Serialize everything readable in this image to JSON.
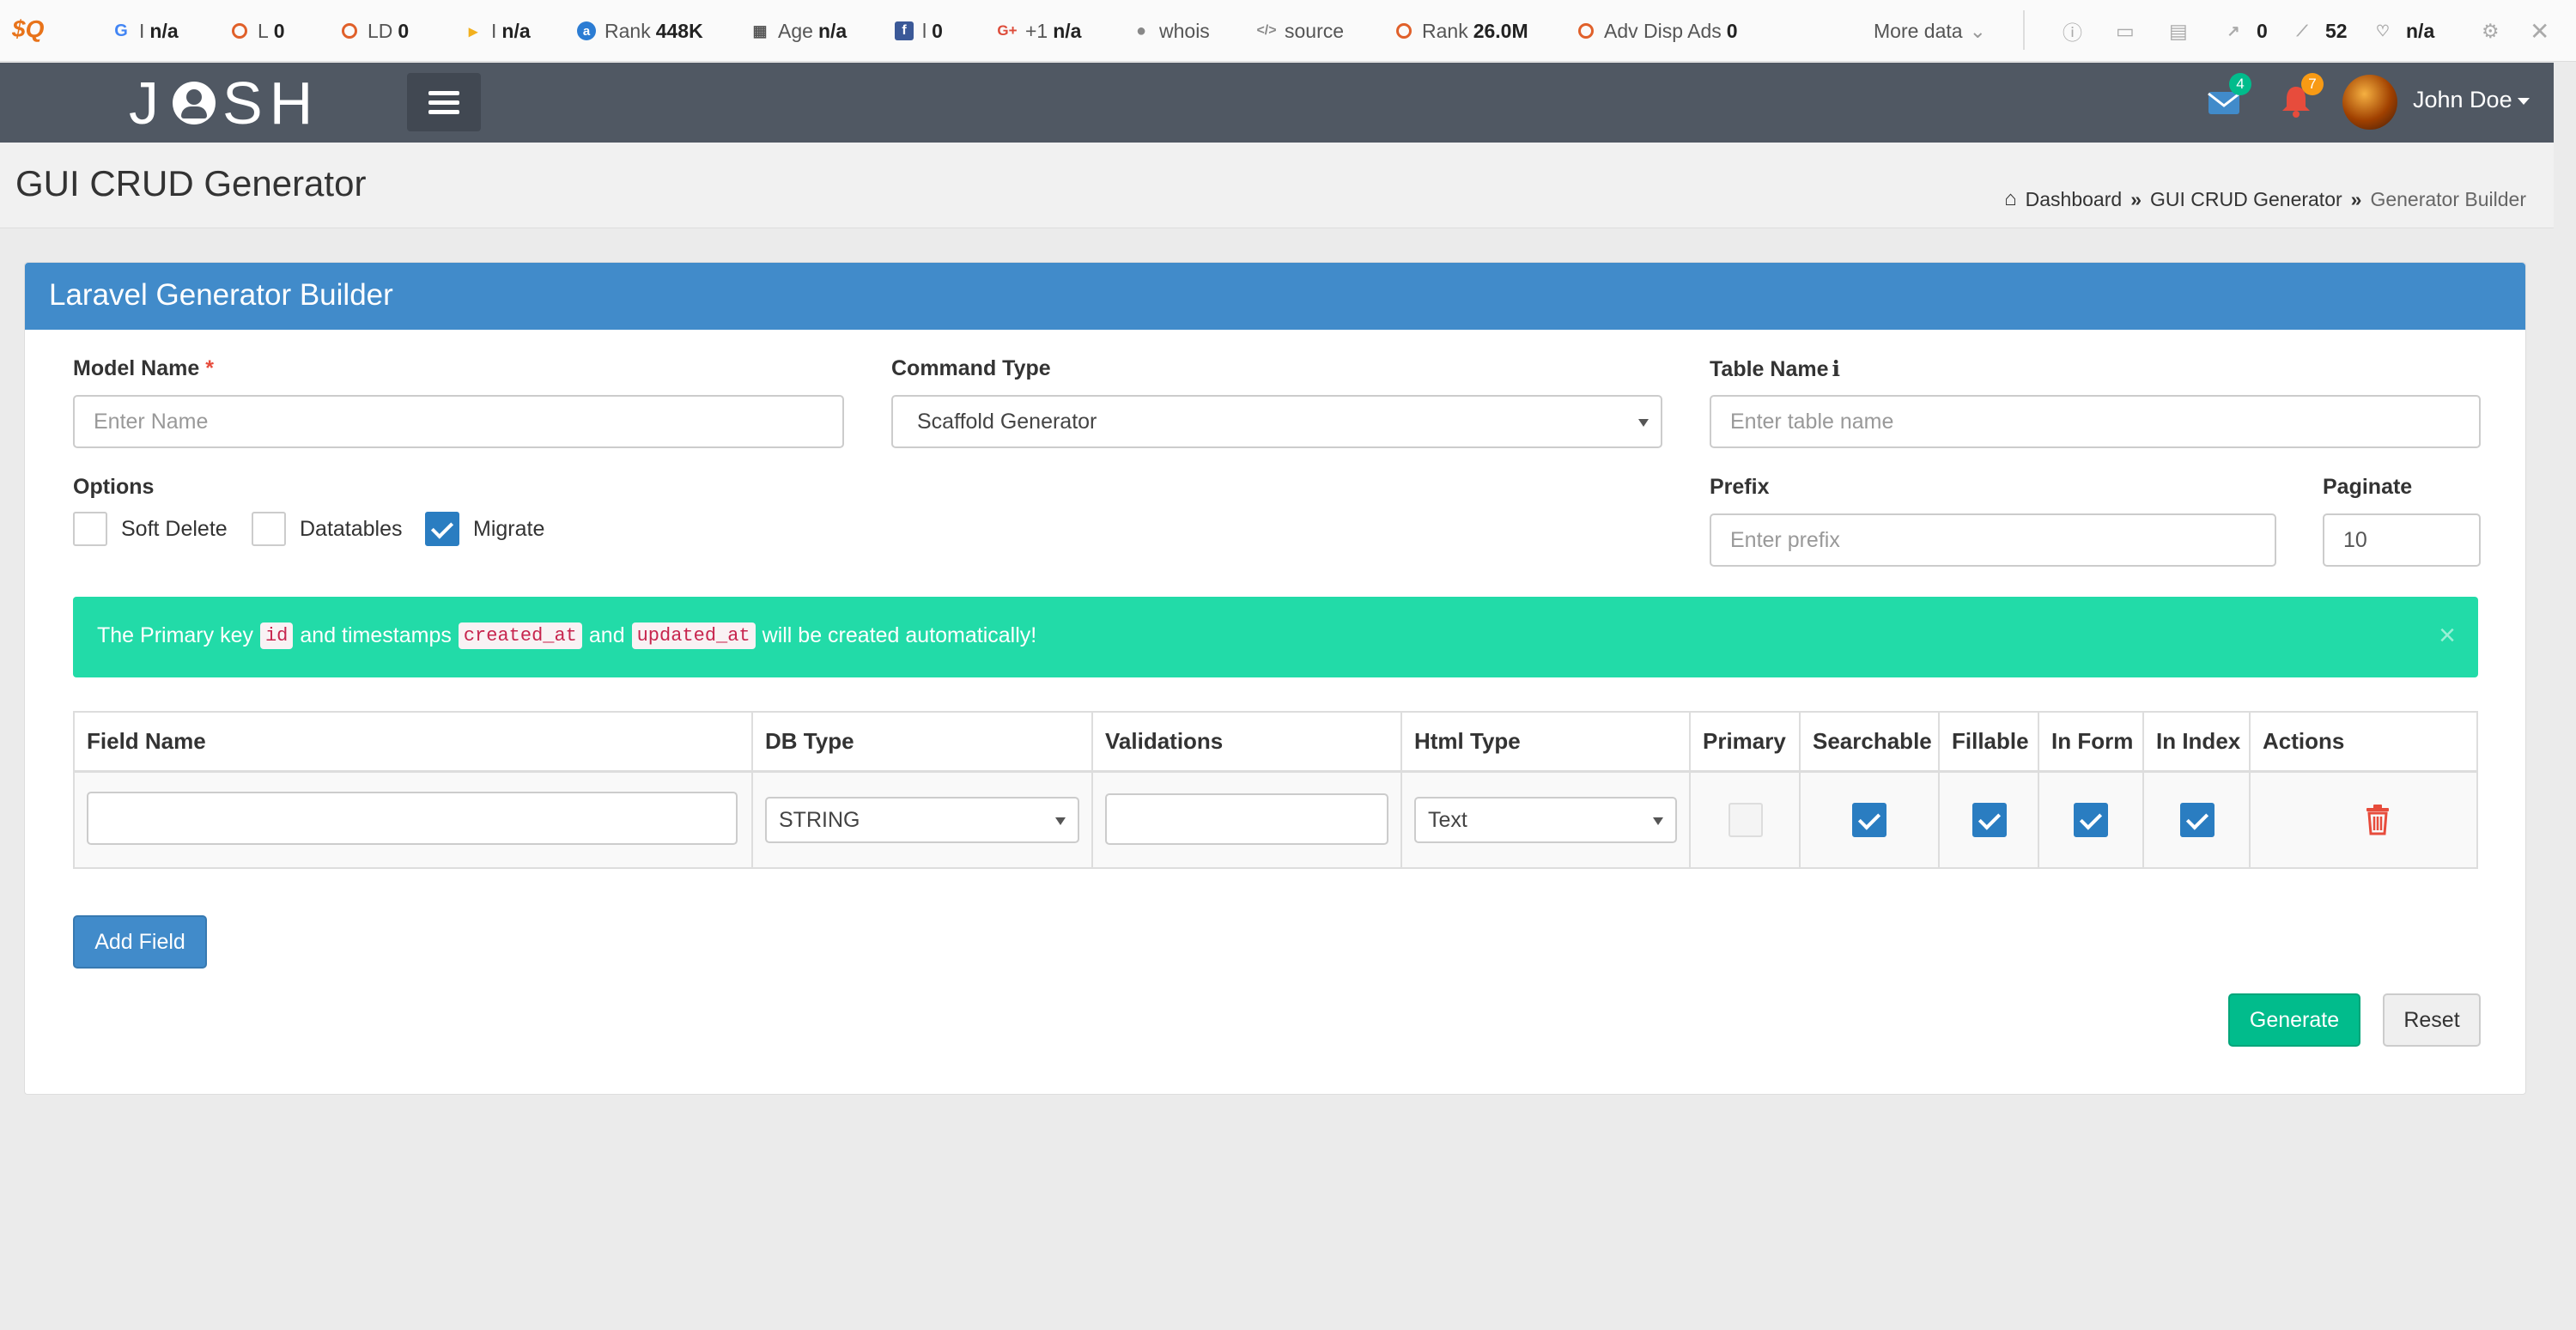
{
  "seobar": {
    "items": [
      {
        "icon": "google-icon",
        "label": "I",
        "value": "n/a",
        "color": "#4285f4"
      },
      {
        "icon": "circle-icon",
        "label": "L",
        "value": "0"
      },
      {
        "icon": "circle-icon",
        "label": "LD",
        "value": "0"
      },
      {
        "icon": "bing-icon",
        "label": "I",
        "value": "n/a"
      },
      {
        "icon": "alexa-icon",
        "label": "Rank",
        "value": "448K"
      },
      {
        "icon": "calendar-icon",
        "label": "Age",
        "value": "n/a"
      },
      {
        "icon": "facebook-icon",
        "label": "l",
        "value": "0"
      },
      {
        "icon": "google-plus-icon",
        "label": "+1",
        "value": "n/a"
      },
      {
        "icon": "person-icon",
        "label": "whois",
        "value": ""
      },
      {
        "icon": "code-icon",
        "label": "source",
        "value": ""
      },
      {
        "icon": "circle-icon",
        "label": "Rank",
        "value": "26.0M"
      },
      {
        "icon": "circle-icon",
        "label": "Adv Disp Ads",
        "value": "0"
      }
    ],
    "more_data": "More data",
    "right_values": {
      "links": "0",
      "pages": "52",
      "heart": "n/a"
    }
  },
  "navbar": {
    "logo_left": "J",
    "logo_right": "SH",
    "mail_count": "4",
    "notif_count": "7",
    "user_name": "John Doe",
    "colors": {
      "bar": "#505863",
      "mail_badge": "#01bc8c",
      "notif_badge": "#f89a14"
    }
  },
  "header": {
    "title": "GUI CRUD Generator",
    "breadcrumb": [
      "Dashboard",
      "GUI CRUD Generator",
      "Generator Builder"
    ]
  },
  "panel": {
    "title": "Laravel Generator Builder",
    "model_name": {
      "label": "Model Name",
      "required": "*",
      "placeholder": "Enter Name"
    },
    "command_type": {
      "label": "Command Type",
      "value": "Scaffold Generator"
    },
    "table_name": {
      "label": "Table Name",
      "info": "i",
      "placeholder": "Enter table name"
    },
    "options": {
      "label": "Options",
      "items": [
        {
          "label": "Soft Delete",
          "checked": false
        },
        {
          "label": "Datatables",
          "checked": false
        },
        {
          "label": "Migrate",
          "checked": true
        }
      ]
    },
    "prefix": {
      "label": "Prefix",
      "placeholder": "Enter prefix"
    },
    "paginate": {
      "label": "Paginate",
      "value": "10"
    },
    "alert": {
      "text1": "The Primary key",
      "code1": "id",
      "text2": "and timestamps",
      "code2": "created_at",
      "text3": "and",
      "code3": "updated_at",
      "text4": "will be created automatically!",
      "close": "×"
    },
    "table": {
      "headers": [
        "Field Name",
        "DB Type",
        "Validations",
        "Html Type",
        "Primary",
        "Searchable",
        "Fillable",
        "In Form",
        "In Index",
        "Actions"
      ],
      "row": {
        "field_name": "",
        "db_type": "STRING",
        "validations": "",
        "html_type": "Text",
        "primary": false,
        "searchable": true,
        "fillable": true,
        "in_form": true,
        "in_index": true
      }
    },
    "buttons": {
      "add_field": "Add Field",
      "generate": "Generate",
      "reset": "Reset"
    },
    "colors": {
      "heading": "#418bca",
      "alert": "#22dba8",
      "generate": "#01bc8c",
      "checkbox": "#2a7dc1",
      "trash": "#e74c3c"
    }
  }
}
